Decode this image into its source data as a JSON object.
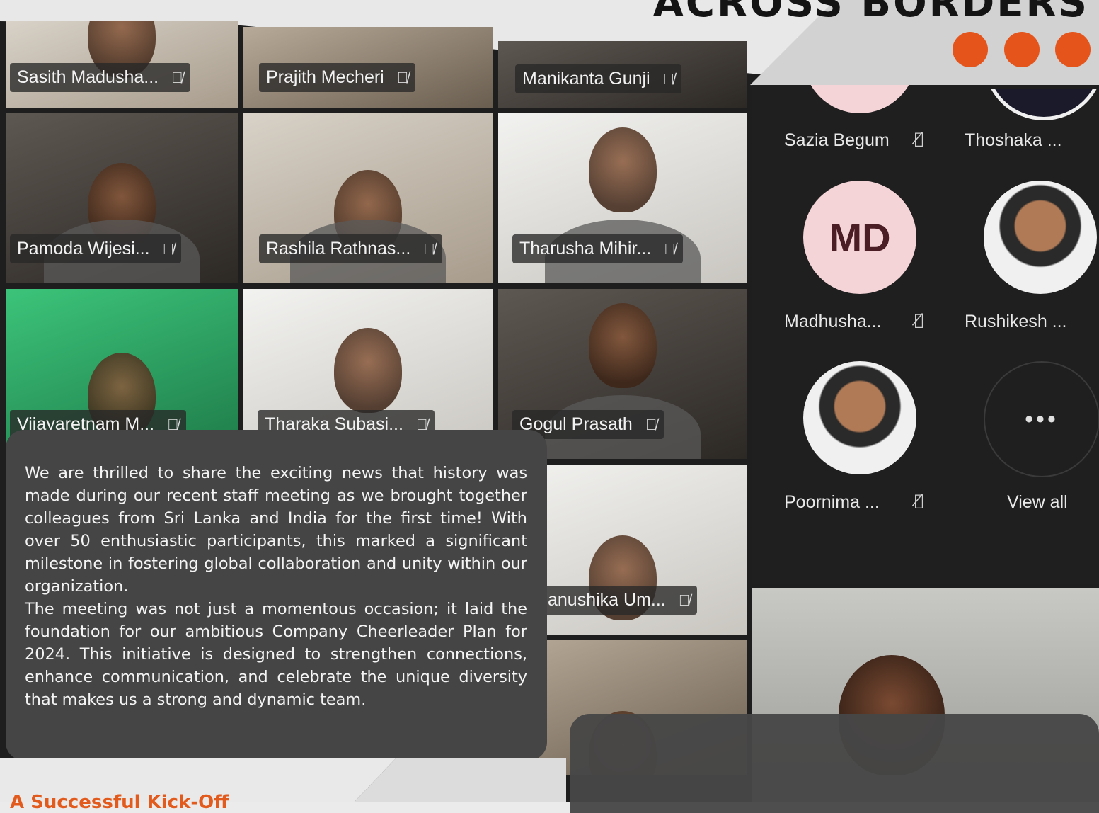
{
  "header": {
    "title": "ACROSS BORDERS",
    "accent_color": "#e5541b",
    "dots": 3
  },
  "grid_tiles": [
    {
      "name": "Sasith Madusha..."
    },
    {
      "name": "Prajith Mecheri"
    },
    {
      "name": "Manikanta Gunji"
    },
    {
      "name": "Pamoda Wijesi..."
    },
    {
      "name": "Rashila Rathnas..."
    },
    {
      "name": "Tharusha Mihir..."
    },
    {
      "name": "Vijayaretnam M..."
    },
    {
      "name": "Tharaka Subasi..."
    },
    {
      "name": "Gogul Prasath"
    },
    {
      "name": "anushika Um..."
    }
  ],
  "participants_panel": {
    "people": [
      {
        "name": "Sazia Begum"
      },
      {
        "name": "Thoshaka ..."
      },
      {
        "name": "Madhusha...",
        "initials": "MD"
      },
      {
        "name": "Rushikesh ..."
      },
      {
        "name": "Poornima ..."
      }
    ],
    "more_label": "•••",
    "view_all": "View all"
  },
  "article": {
    "paragraph1": "We are thrilled to share the exciting news that history was made during our recent staff meeting as we brought together colleagues from Sri Lanka and India for the first time! With over 50 enthusiastic participants, this marked a significant milestone in fostering global collaboration and unity within our organization.",
    "paragraph2": "The meeting was not just a momentous occasion; it laid the foundation for our ambitious Company Cheerleader Plan for 2024. This initiative is designed to strengthen connections, enhance communication, and celebrate the unique diversity that makes us a strong and dynamic team."
  },
  "footer": {
    "heading": "A Successful Kick-Off"
  }
}
